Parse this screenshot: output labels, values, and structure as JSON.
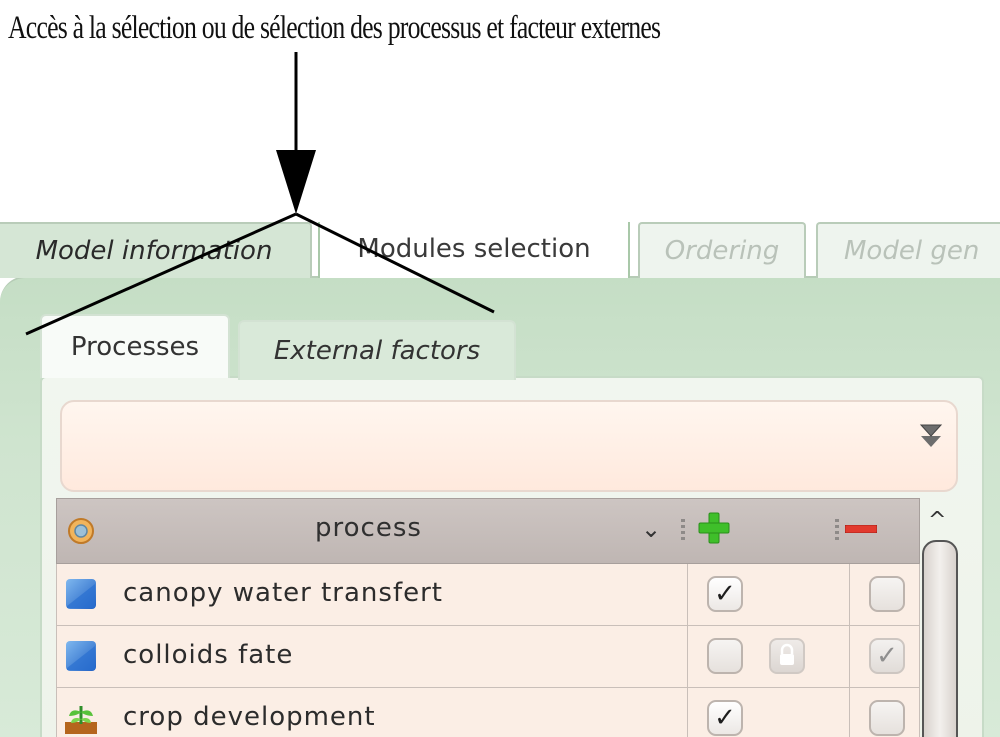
{
  "caption": "Accès à la sélection ou de sélection des processus et facteur externes",
  "top_tabs": [
    {
      "label": "Model information"
    },
    {
      "label": "Modules selection"
    },
    {
      "label": "Ordering"
    },
    {
      "label": "Model gen"
    }
  ],
  "inner_tabs": [
    {
      "label": "Processes"
    },
    {
      "label": "External factors"
    }
  ],
  "table": {
    "column_header": "process",
    "rows": [
      {
        "name": "canopy water transfert",
        "icon": "blue-module-icon",
        "add_checked": true,
        "add_locked": false,
        "remove_checked": false
      },
      {
        "name": "colloids fate",
        "icon": "blue-module-icon",
        "add_checked": false,
        "add_locked": true,
        "remove_checked": true
      },
      {
        "name": "crop development",
        "icon": "crop-plant-icon",
        "add_checked": true,
        "add_locked": false,
        "remove_checked": false
      }
    ]
  },
  "colors": {
    "tab_green": "#d5e6d5",
    "panel_green": "#cfe4cf",
    "header_gray": "#c4bcb9",
    "row_peach": "#fbeee5",
    "plus_green": "#3fbf2a",
    "minus_red": "#e23a2e"
  }
}
